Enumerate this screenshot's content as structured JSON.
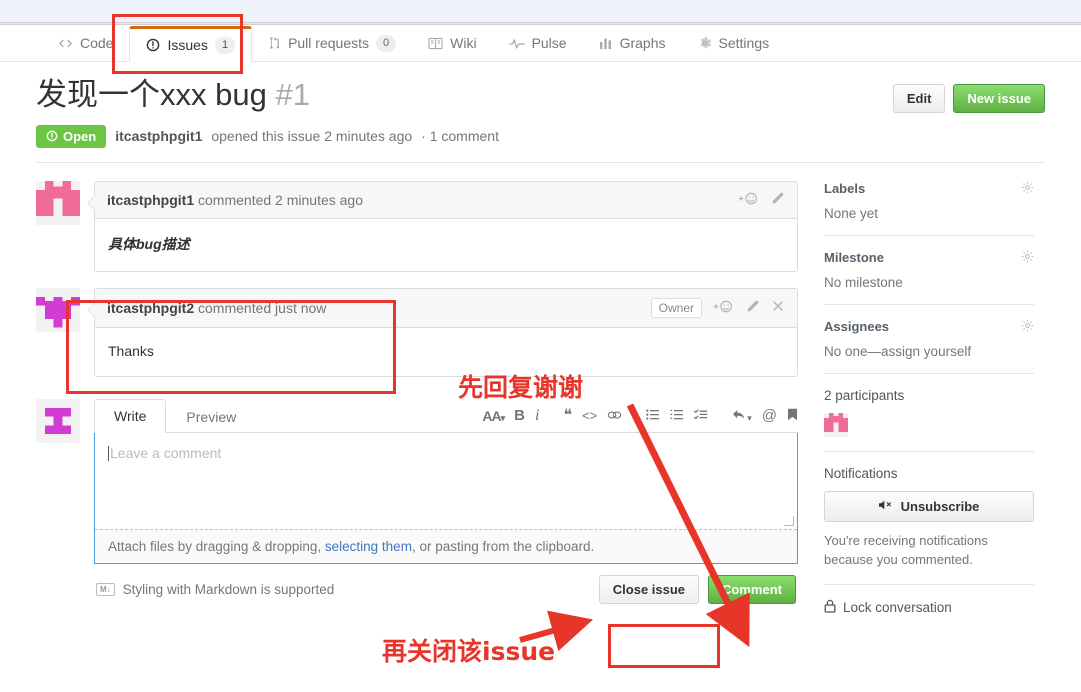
{
  "nav": {
    "items": [
      {
        "label": "Code",
        "icon": "code-icon",
        "count": null,
        "active": false
      },
      {
        "label": "Issues",
        "icon": "issue-opened-icon",
        "count": "1",
        "active": true
      },
      {
        "label": "Pull requests",
        "icon": "git-pull-request-icon",
        "count": "0",
        "active": false
      },
      {
        "label": "Wiki",
        "icon": "book-icon",
        "count": null,
        "active": false
      },
      {
        "label": "Pulse",
        "icon": "pulse-icon",
        "count": null,
        "active": false
      },
      {
        "label": "Graphs",
        "icon": "graph-icon",
        "count": null,
        "active": false
      },
      {
        "label": "Settings",
        "icon": "gear-icon",
        "count": null,
        "active": false
      }
    ]
  },
  "issue": {
    "title": "发现一个xxx bug",
    "number": "#1",
    "state": "Open",
    "author": "itcastphpgit1",
    "meta_opened": "opened this issue 2 minutes ago",
    "meta_comments": "· 1 comment",
    "edit_label": "Edit",
    "new_issue_label": "New issue"
  },
  "comments": [
    {
      "author": "itcastphpgit1",
      "meta": "commented 2 minutes ago",
      "body": "具体bug描述",
      "owner_tag": null,
      "avatar_color": "#ef6b9a",
      "body_style": "zh"
    },
    {
      "author": "itcastphpgit2",
      "meta": "commented just now",
      "body": "Thanks",
      "owner_tag": "Owner",
      "avatar_color": "#d43bd4",
      "body_style": ""
    }
  ],
  "editor": {
    "tab_write": "Write",
    "tab_preview": "Preview",
    "placeholder": "Leave a comment",
    "attach_pre": "Attach files by dragging & dropping, ",
    "attach_link": "selecting them",
    "attach_post": ", or pasting from the clipboard.",
    "markdown_note": "Styling with Markdown is supported",
    "markdown_badge": "M↓",
    "close_issue_label": "Close issue",
    "comment_label": "Comment",
    "toolbar": [
      {
        "name": "heading-icon",
        "glyph": "AA"
      },
      {
        "name": "bold-icon",
        "glyph": "B"
      },
      {
        "name": "italic-icon",
        "glyph": "i"
      },
      {
        "name": "quote-icon",
        "glyph": "❝"
      },
      {
        "name": "code-icon",
        "glyph": "<>"
      },
      {
        "name": "link-icon",
        "glyph": "🔗"
      },
      {
        "name": "unordered-list-icon",
        "glyph": "☰"
      },
      {
        "name": "ordered-list-icon",
        "glyph": "☷"
      },
      {
        "name": "task-list-icon",
        "glyph": "☑"
      },
      {
        "name": "reply-icon",
        "glyph": "↰"
      },
      {
        "name": "mention-icon",
        "glyph": "@"
      },
      {
        "name": "saved-replies-icon",
        "glyph": "🔖"
      }
    ]
  },
  "sidebar": {
    "labels_title": "Labels",
    "labels_value": "None yet",
    "milestone_title": "Milestone",
    "milestone_value": "No milestone",
    "assignees_title": "Assignees",
    "assignees_value": "No one—assign yourself",
    "participants_title": "2 participants",
    "notifications_title": "Notifications",
    "unsubscribe_label": "Unsubscribe",
    "notifications_note": "You're receiving notifications because you commented.",
    "lock_label": "Lock conversation"
  },
  "annotations": {
    "reply_first": "先回复谢谢",
    "then_close": "再关闭该issue"
  },
  "colors": {
    "open_green": "#6cc644",
    "button_green": "#60b044",
    "annotation_red": "#e8352a",
    "active_tab_orange": "#d26911",
    "link_blue": "#4078c0"
  }
}
